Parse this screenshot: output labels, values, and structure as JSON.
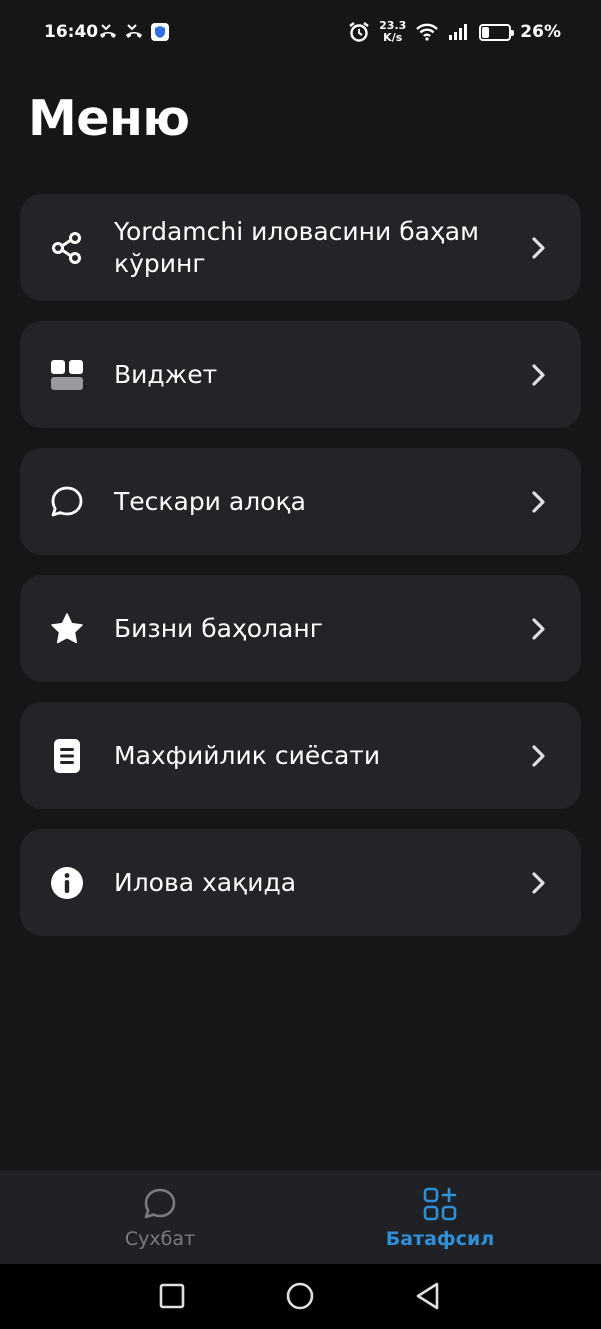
{
  "status_bar": {
    "time": "16:40",
    "network_speed_value": "23.3",
    "network_speed_unit": "K/s",
    "battery_percent": "26%",
    "battery_level": 0.26
  },
  "page": {
    "title": "Меню"
  },
  "menu": {
    "items": [
      {
        "label": "Yordamchi иловасини баҳам кўринг",
        "icon": "share-icon"
      },
      {
        "label": "Виджет",
        "icon": "widget-icon"
      },
      {
        "label": "Тескари алоқа",
        "icon": "chat-bubble-icon"
      },
      {
        "label": "Бизни баҳоланг",
        "icon": "star-icon"
      },
      {
        "label": "Махфийлик сиёсати",
        "icon": "document-icon"
      },
      {
        "label": "Илова хақида",
        "icon": "info-icon"
      }
    ]
  },
  "bottom_nav": {
    "tabs": [
      {
        "label": "Сухбат",
        "icon": "chat-bubble-icon",
        "active": false
      },
      {
        "label": "Батафсил",
        "icon": "grid-plus-icon",
        "active": true
      }
    ],
    "active_color": "#2f8fd9",
    "inactive_color": "#7a7b7f"
  },
  "colors": {
    "background": "#161618",
    "card": "#232427",
    "nav_bar": "#202124"
  }
}
